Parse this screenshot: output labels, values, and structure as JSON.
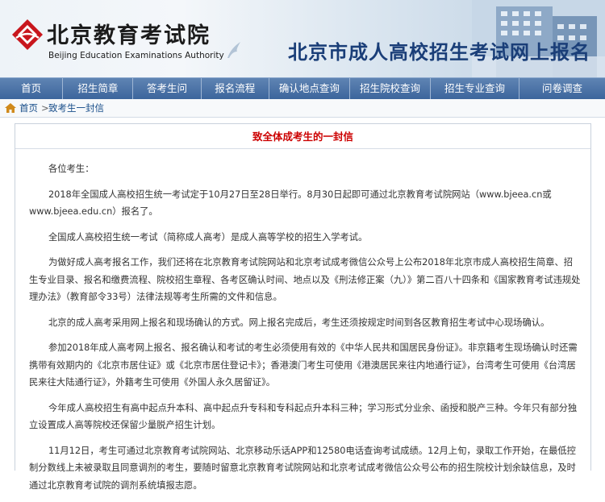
{
  "header": {
    "logo_cn": "北京教育考试院",
    "logo_en": "Beijing Education Examinations Authority",
    "site_title": "北京市成人高校招生考试网上报名",
    "logo_icon": "beijing-education-exam-authority-logo-icon",
    "accent_color": "#1a3e78"
  },
  "nav": {
    "items": [
      {
        "label": "首页"
      },
      {
        "label": "招生简章"
      },
      {
        "label": "答考生问"
      },
      {
        "label": "报名流程"
      },
      {
        "label": "确认地点查询"
      },
      {
        "label": "招生院校查询"
      },
      {
        "label": "招生专业查询"
      },
      {
        "label": "问卷调查"
      }
    ]
  },
  "breadcrumb": {
    "home": "首页",
    "separator": ">",
    "current": "致考生一封信",
    "home_icon": "home-icon"
  },
  "letter": {
    "title": "致全体成考生的一封信",
    "title_color": "#cc0000",
    "paragraphs": [
      "各位考生：",
      "2018年全国成人高校招生统一考试定于10月27日至28日举行。8月30日起即可通过北京教育考试院网站（www.bjeea.cn或www.bjeea.edu.cn）报名了。",
      "全国成人高校招生统一考试（简称成人高考）是成人高等学校的招生入学考试。",
      "为做好成人高考报名工作，我们还将在北京教育考试院网站和北京考试成考微信公众号上公布2018年北京市成人高校招生简章、招生专业目录、报名和缴费流程、院校招生章程、各考区确认时间、地点以及《刑法修正案（九）》第二百八十四条和《国家教育考试违规处理办法》（教育部令33号）法律法规等考生所需的文件和信息。",
      "北京的成人高考采用网上报名和现场确认的方式。网上报名完成后，考生还须按规定时间到各区教育招生考试中心现场确认。",
      "参加2018年成人高考网上报名、报名确认和考试的考生必须使用有效的《中华人民共和国居民身份证》。非京籍考生现场确认时还需携带有效期内的《北京市居住证》或《北京市居住登记卡》；香港澳门考生可使用《港澳居民来往内地通行证》，台湾考生可使用《台湾居民来往大陆通行证》，外籍考生可使用《外国人永久居留证》。",
      "今年成人高校招生有高中起点升本科、高中起点升专科和专科起点升本科三种；学习形式分业余、函授和脱产三种。今年只有部分独立设置成人高等院校还保留少量脱产招生计划。",
      "11月12日，考生可通过北京教育考试院网站、北京移动乐话APP和12580电话查询考试成绩。12月上旬，录取工作开始，在最低控制分数线上未被录取且同意调剂的考生，要随时留意北京教育考试院网站和北京考试成考微信公众号公布的招生院校计划余缺信息，及时通过北京教育考试院的调剂系统填报志愿。"
    ]
  }
}
